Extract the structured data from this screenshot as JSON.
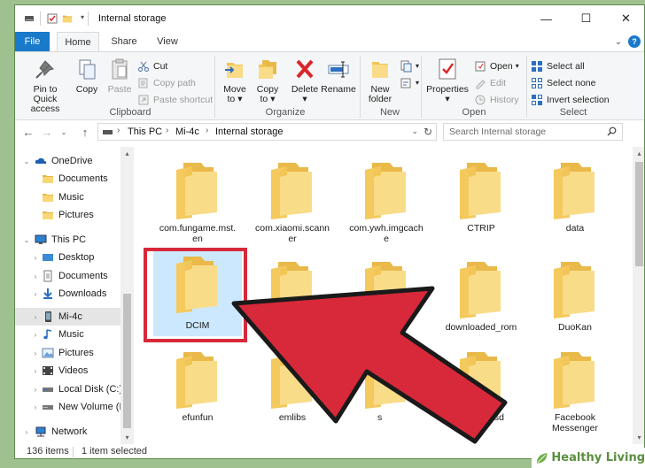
{
  "window": {
    "title": "Internal storage"
  },
  "tabs": [
    {
      "label": "File"
    },
    {
      "label": "Home"
    },
    {
      "label": "Share"
    },
    {
      "label": "View"
    }
  ],
  "ribbon": {
    "clipboard": {
      "label": "Clipboard",
      "pin": "Pin to Quick",
      "pin2": "access",
      "copy": "Copy",
      "paste": "Paste",
      "cut": "Cut",
      "copy_path": "Copy path",
      "paste_shortcut": "Paste shortcut"
    },
    "organize": {
      "label": "Organize",
      "move": "Move",
      "move2": "to",
      "copy": "Copy",
      "copy2": "to",
      "delete": "Delete",
      "rename": "Rename"
    },
    "new": {
      "label": "New",
      "new_folder": "New",
      "new_folder2": "folder"
    },
    "open": {
      "label": "Open",
      "properties": "Properties",
      "open": "Open",
      "edit": "Edit",
      "history": "History"
    },
    "select": {
      "label": "Select",
      "select_all": "Select all",
      "select_none": "Select none",
      "invert": "Invert selection"
    }
  },
  "address": {
    "crumbs": [
      "This PC",
      "Mi-4c",
      "Internal storage"
    ],
    "search_placeholder": "Search Internal storage"
  },
  "nav": {
    "items": [
      {
        "label": "OneDrive"
      },
      {
        "label": "Documents"
      },
      {
        "label": "Music"
      },
      {
        "label": "Pictures"
      },
      {
        "label": "This PC"
      },
      {
        "label": "Desktop"
      },
      {
        "label": "Documents"
      },
      {
        "label": "Downloads"
      },
      {
        "label": "Mi-4c"
      },
      {
        "label": "Music"
      },
      {
        "label": "Pictures"
      },
      {
        "label": "Videos"
      },
      {
        "label": "Local Disk (C:)"
      },
      {
        "label": "New Volume (D:"
      },
      {
        "label": "Network"
      }
    ]
  },
  "files": [
    {
      "name": "com.fungame.mst.en"
    },
    {
      "name": "com.xiaomi.scanner"
    },
    {
      "name": "com.ywh.imgcache"
    },
    {
      "name": "CTRIP"
    },
    {
      "name": "data"
    },
    {
      "name": "DCIM"
    },
    {
      "name": ""
    },
    {
      "name": ""
    },
    {
      "name": "downloaded_rom"
    },
    {
      "name": "DuoKan"
    },
    {
      "name": "efunfun"
    },
    {
      "name": "emlibs"
    },
    {
      "name": "s"
    },
    {
      "name": "external-sd"
    },
    {
      "name": "Facebook Messenger"
    }
  ],
  "status": {
    "items": "136 items",
    "selected": "1 item selected"
  },
  "watermark": {
    "text": "Healthy Living"
  },
  "colors": {
    "highlight_red": "#d7293a",
    "selection_blue": "#cce8ff",
    "folder_yellow": "#f7d674",
    "file_tab_blue": "#1979ca",
    "background_green": "#9fc18f"
  }
}
